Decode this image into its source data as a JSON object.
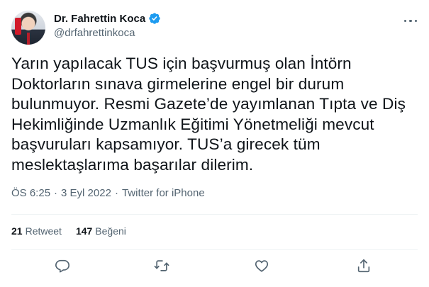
{
  "author": {
    "name": "Dr. Fahrettin Koca",
    "handle": "@drfahrettinkoca",
    "verified_icon": "verified-badge-icon",
    "verified_color": "#1d9bf0"
  },
  "tweet": {
    "text": "Yarın yapılacak TUS için başvurmuş olan İntörn\nDoktorların sınava girmelerine engel bir durum\nbulunmuyor. Resmi Gazete’de yayımlanan Tıpta ve Diş\nHekimliğinde Uzmanlık Eğitimi Yönetmeliği mevcut\nbaşvuruları kapsamıyor. TUS’a girecek tüm\nmeslektaşlarıma başarılar dilerim.",
    "time": "ÖS 6:25",
    "separator": "·",
    "date": "3 Eyl 2022",
    "source": "Twitter for iPhone"
  },
  "stats": {
    "retweets_count": "21",
    "retweets_label": "Retweet",
    "likes_count": "147",
    "likes_label": "Beğeni"
  },
  "actions": [
    "reply-icon",
    "retweet-icon",
    "like-icon",
    "share-icon"
  ],
  "colors": {
    "text": "#0f1419",
    "secondary": "#536471",
    "divider": "#eff3f4"
  }
}
